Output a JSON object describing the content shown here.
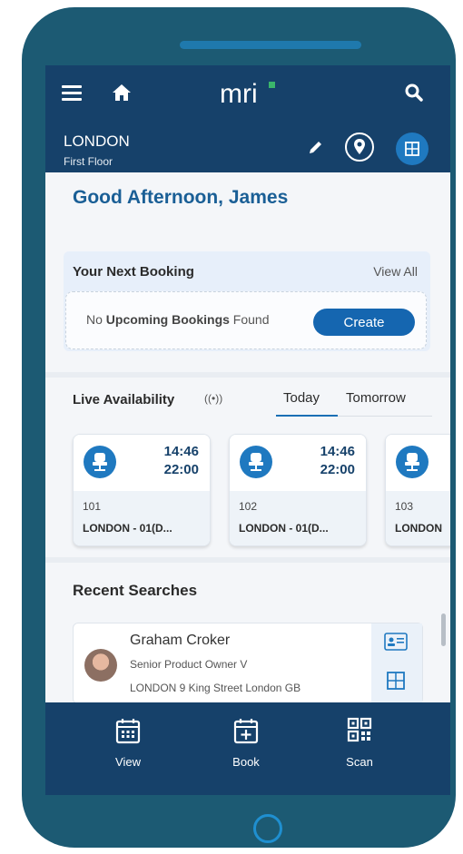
{
  "header": {
    "brand": "mri",
    "location": "LONDON",
    "floor": "First Floor"
  },
  "greeting": "Good Afternoon, James",
  "next_booking": {
    "title": "Your Next Booking",
    "view_all": "View All",
    "empty_prefix": "No ",
    "empty_bold": "Upcoming Bookings",
    "empty_suffix": " Found",
    "create_label": "Create"
  },
  "live": {
    "title": "Live Availability",
    "tabs": [
      {
        "label": "Today",
        "active": true
      },
      {
        "label": "Tomorrow",
        "active": false
      }
    ],
    "cards": [
      {
        "start": "14:46",
        "end": "22:00",
        "number": "101",
        "name": "LONDON - 01(D..."
      },
      {
        "start": "14:46",
        "end": "22:00",
        "number": "102",
        "name": "LONDON - 01(D..."
      },
      {
        "start": "",
        "end": "",
        "number": "103",
        "name": "LONDON"
      }
    ]
  },
  "recent": {
    "title": "Recent Searches",
    "person": {
      "name": "Graham Croker",
      "role": "Senior Product Owner V",
      "location": "LONDON 9 King Street London GB"
    }
  },
  "nav": [
    {
      "label": "View",
      "icon": "calendar-view-icon"
    },
    {
      "label": "Book",
      "icon": "calendar-add-icon"
    },
    {
      "label": "Scan",
      "icon": "qr-code-icon"
    }
  ],
  "colors": {
    "device": "#1c5a73",
    "header": "#16416a",
    "accent": "#1566b0",
    "greeting": "#1a5f96"
  }
}
